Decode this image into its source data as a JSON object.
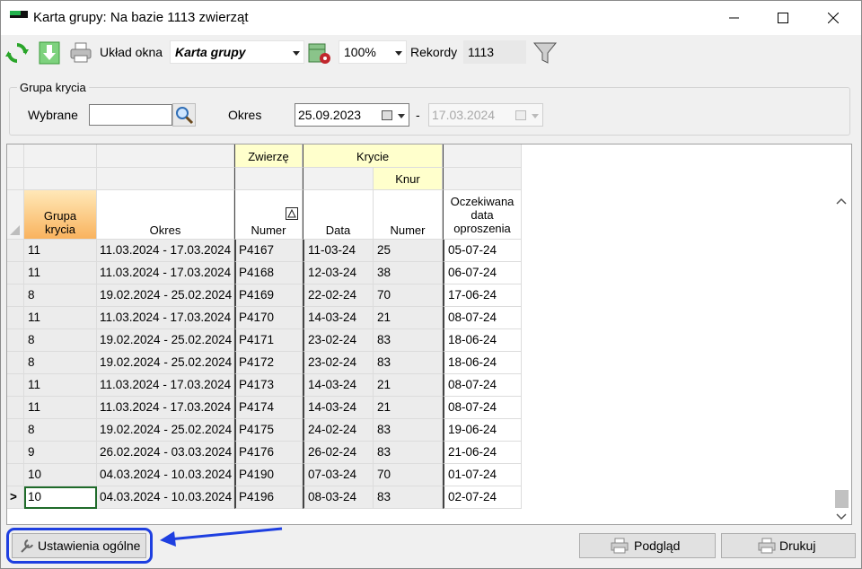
{
  "window": {
    "title": "Karta grupy: Na bazie 1113 zwierząt"
  },
  "toolbar": {
    "refresh_icon": "refresh-icon",
    "export_icon": "download-icon",
    "print_icon": "printer-icon",
    "layout_label": "Układ okna",
    "layout_value": "Karta grupy",
    "settings_icon": "layout-settings-icon",
    "zoom_value": "100%",
    "records_label": "Rekordy",
    "records_value": "1113",
    "filter_icon": "filter-icon"
  },
  "filter": {
    "group_title": "Grupa krycia",
    "selected_label": "Wybrane",
    "selected_value": "",
    "period_label": "Okres",
    "date_from": "25.09.2023",
    "separator": "-",
    "date_to": "17.03.2024"
  },
  "grid": {
    "header": {
      "zwierze": "Zwierzę",
      "krycie": "Krycie",
      "knur": "Knur",
      "grupa_krycia": "Grupa krycia",
      "okres": "Okres",
      "numer": "Numer",
      "data": "Data",
      "knur_numer": "Numer",
      "oczekiwana": "Oczekiwana data oproszenia"
    },
    "rows": [
      {
        "grupa": "11",
        "okres": "11.03.2024 - 17.03.2024",
        "numer": "P4167",
        "data": "11-03-24",
        "knur": "25",
        "oczekiwana": "05-07-24"
      },
      {
        "grupa": "11",
        "okres": "11.03.2024 - 17.03.2024",
        "numer": "P4168",
        "data": "12-03-24",
        "knur": "38",
        "oczekiwana": "06-07-24"
      },
      {
        "grupa": "8",
        "okres": "19.02.2024 - 25.02.2024",
        "numer": "P4169",
        "data": "22-02-24",
        "knur": "70",
        "oczekiwana": "17-06-24"
      },
      {
        "grupa": "11",
        "okres": "11.03.2024 - 17.03.2024",
        "numer": "P4170",
        "data": "14-03-24",
        "knur": "21",
        "oczekiwana": "08-07-24"
      },
      {
        "grupa": "8",
        "okres": "19.02.2024 - 25.02.2024",
        "numer": "P4171",
        "data": "23-02-24",
        "knur": "83",
        "oczekiwana": "18-06-24"
      },
      {
        "grupa": "8",
        "okres": "19.02.2024 - 25.02.2024",
        "numer": "P4172",
        "data": "23-02-24",
        "knur": "83",
        "oczekiwana": "18-06-24"
      },
      {
        "grupa": "11",
        "okres": "11.03.2024 - 17.03.2024",
        "numer": "P4173",
        "data": "14-03-24",
        "knur": "21",
        "oczekiwana": "08-07-24"
      },
      {
        "grupa": "11",
        "okres": "11.03.2024 - 17.03.2024",
        "numer": "P4174",
        "data": "14-03-24",
        "knur": "21",
        "oczekiwana": "08-07-24"
      },
      {
        "grupa": "8",
        "okres": "19.02.2024 - 25.02.2024",
        "numer": "P4175",
        "data": "24-02-24",
        "knur": "83",
        "oczekiwana": "19-06-24"
      },
      {
        "grupa": "9",
        "okres": "26.02.2024 - 03.03.2024",
        "numer": "P4176",
        "data": "26-02-24",
        "knur": "83",
        "oczekiwana": "21-06-24"
      },
      {
        "grupa": "10",
        "okres": "04.03.2024 - 10.03.2024",
        "numer": "P4190",
        "data": "07-03-24",
        "knur": "70",
        "oczekiwana": "01-07-24"
      },
      {
        "grupa": "10",
        "okres": "04.03.2024 - 10.03.2024",
        "numer": "P4196",
        "data": "08-03-24",
        "knur": "83",
        "oczekiwana": "02-07-24"
      }
    ],
    "current_row_marker": ">"
  },
  "footer": {
    "settings_label": "Ustawienia ogólne",
    "preview_label": "Podgląd",
    "print_label": "Drukuj"
  },
  "colors": {
    "annotation": "#1e3fe0",
    "header_yellow": "#ffffcc",
    "sorted_header": "#f9b35e"
  }
}
